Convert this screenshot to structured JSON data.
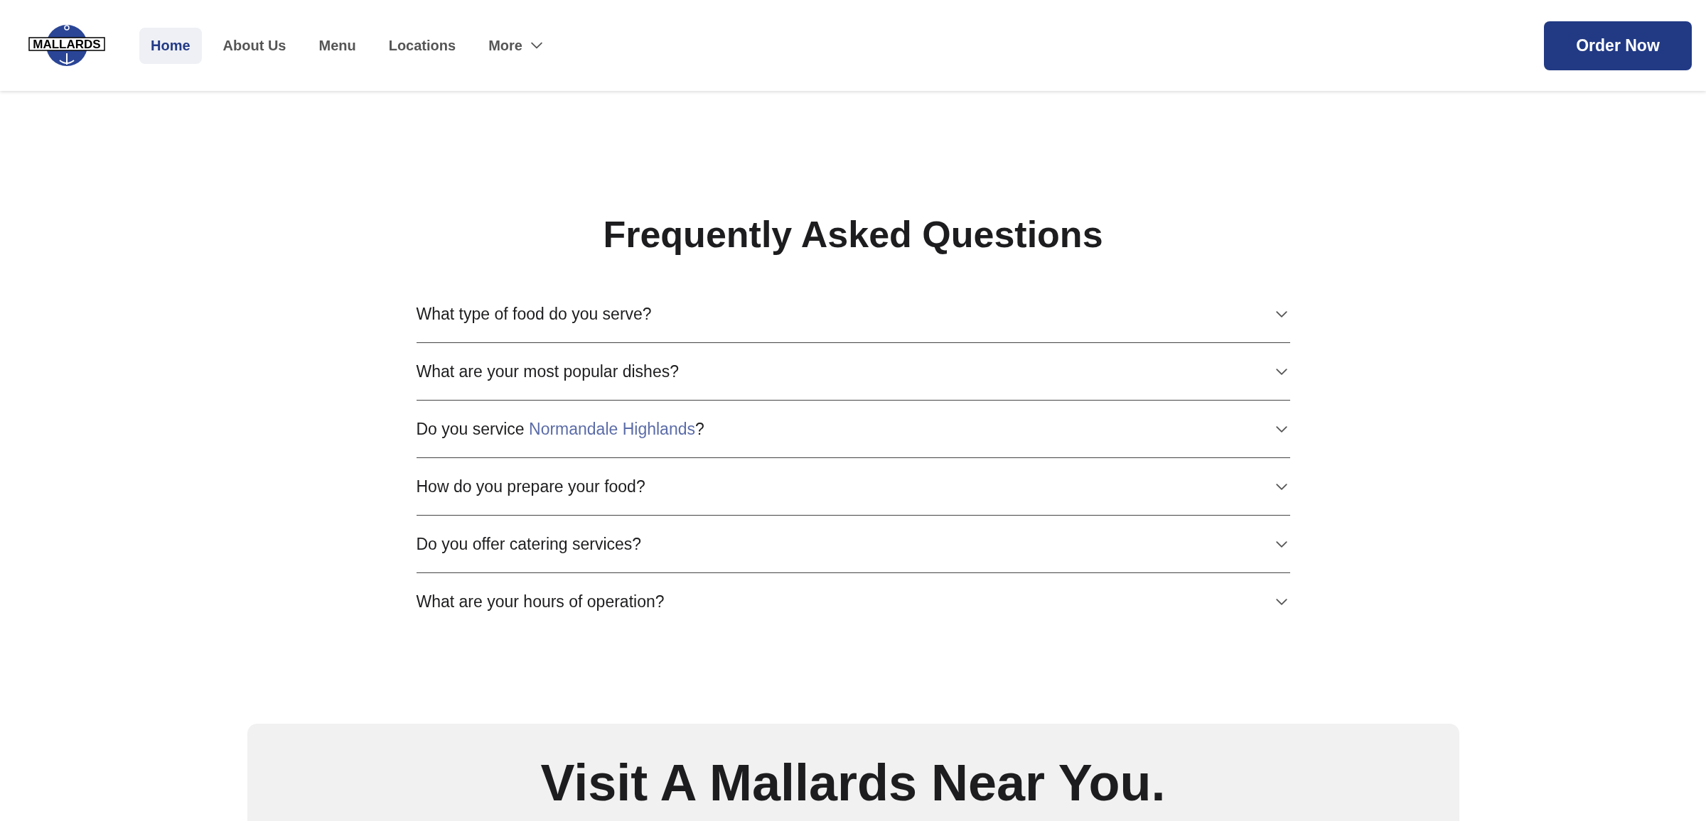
{
  "header": {
    "logo": {
      "text": "MALLARDS"
    },
    "nav": [
      {
        "label": "Home",
        "selected": true,
        "dropdown": false
      },
      {
        "label": "About Us",
        "selected": false,
        "dropdown": false
      },
      {
        "label": "Menu",
        "selected": false,
        "dropdown": false
      },
      {
        "label": "Locations",
        "selected": false,
        "dropdown": false
      },
      {
        "label": "More",
        "selected": false,
        "dropdown": true
      }
    ],
    "cta": "Order Now"
  },
  "faq": {
    "title": "Frequently Asked Questions",
    "items": [
      {
        "parts": [
          {
            "text": "What type of food do you serve?"
          }
        ],
        "expanded": false
      },
      {
        "parts": [
          {
            "text": "What are your most popular dishes?"
          }
        ],
        "expanded": false
      },
      {
        "parts": [
          {
            "text": "Do you service "
          },
          {
            "text": "Normandale Highlands",
            "link": true
          },
          {
            "text": "?"
          }
        ],
        "expanded": false
      },
      {
        "parts": [
          {
            "text": "How do you prepare your food?"
          }
        ],
        "expanded": false
      },
      {
        "parts": [
          {
            "text": "Do you offer catering services?"
          }
        ],
        "expanded": false
      },
      {
        "parts": [
          {
            "text": "What are your hours of operation?"
          }
        ],
        "expanded": false
      }
    ]
  },
  "visit": {
    "title": "Visit A Mallards Near You."
  }
}
